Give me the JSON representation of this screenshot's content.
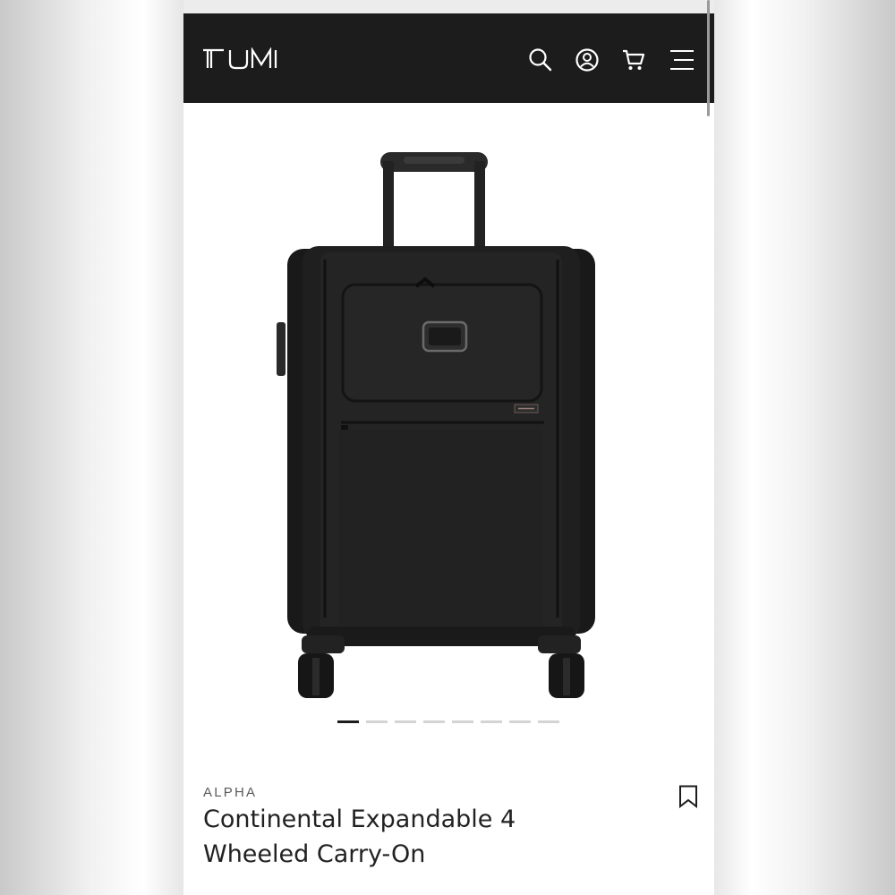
{
  "header": {
    "brand": "TUMI",
    "icons": [
      "search-icon",
      "account-icon",
      "cart-icon",
      "menu-icon"
    ],
    "background_color": "#1c1c1c"
  },
  "gallery": {
    "image": "product-photo",
    "slide_count": 8,
    "active_slide": 1
  },
  "product": {
    "collection": "ALPHA",
    "title": "Continental Expandable 4 Wheeled Carry-On",
    "bookmark_icon": "bookmark-icon"
  }
}
